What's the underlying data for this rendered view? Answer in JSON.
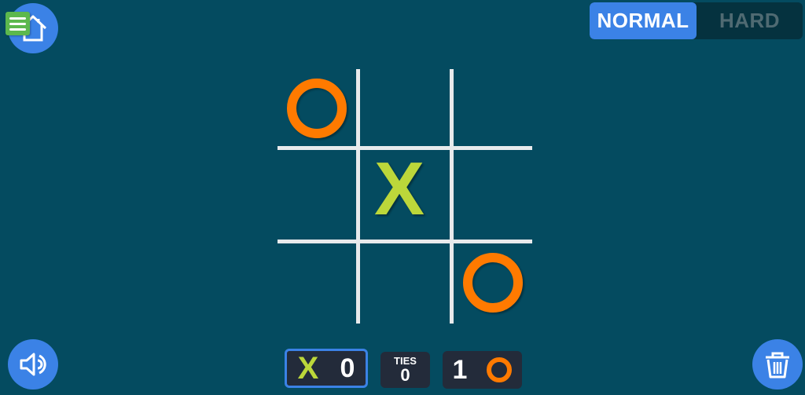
{
  "toolbar": {
    "home_icon": "home-icon",
    "menu_icon": "menu-icon",
    "sound_icon": "speaker-icon",
    "trash_icon": "trash-icon"
  },
  "difficulty": {
    "options": [
      {
        "label": "NORMAL",
        "active": true
      },
      {
        "label": "HARD",
        "active": false
      }
    ]
  },
  "board": {
    "cells": [
      "O",
      "",
      "",
      "",
      "X",
      "",
      "",
      "",
      "O"
    ]
  },
  "scoreboard": {
    "x": {
      "symbol": "X",
      "score": "0",
      "active": true
    },
    "ties": {
      "label": "TIES",
      "score": "0"
    },
    "o": {
      "symbol": "O",
      "score": "1",
      "active": false
    }
  },
  "colors": {
    "background": "#044b60",
    "accent": "#3b82e6",
    "x_color": "#bcd73a",
    "o_color": "#ff7a00",
    "grid": "#e8eaec"
  }
}
